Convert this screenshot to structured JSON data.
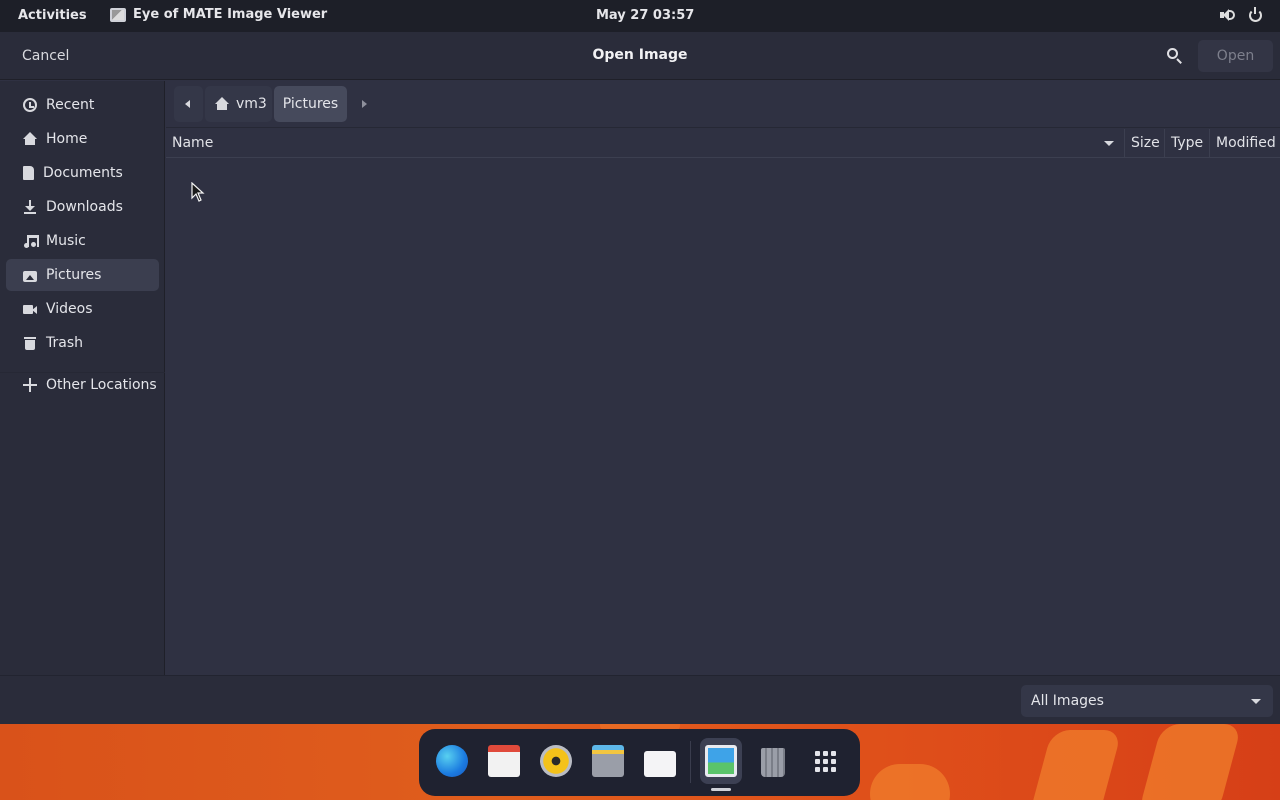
{
  "topbar": {
    "activities": "Activities",
    "app_name": "Eye of MATE Image Viewer",
    "clock": "May 27  03:57",
    "tray_icons": [
      "volume-icon",
      "power-icon"
    ]
  },
  "header": {
    "cancel_label": "Cancel",
    "title": "Open Image",
    "open_label": "Open",
    "search_icon": "search-icon"
  },
  "sidebar": {
    "items": [
      {
        "label": "Recent",
        "icon": "clock-icon"
      },
      {
        "label": "Home",
        "icon": "home-icon"
      },
      {
        "label": "Documents",
        "icon": "document-icon"
      },
      {
        "label": "Downloads",
        "icon": "download-icon"
      },
      {
        "label": "Music",
        "icon": "music-icon"
      },
      {
        "label": "Pictures",
        "icon": "picture-icon",
        "selected": true
      },
      {
        "label": "Videos",
        "icon": "video-icon"
      },
      {
        "label": "Trash",
        "icon": "trash-icon"
      },
      {
        "label": "Other Locations",
        "icon": "plus-icon"
      }
    ]
  },
  "pathbar": {
    "segments": [
      "vm3",
      "Pictures"
    ]
  },
  "columns": [
    "Name",
    "Size",
    "Type",
    "Modified"
  ],
  "files": [],
  "footer": {
    "filter_value": "All Images"
  },
  "dock": {
    "apps": [
      "browser-icon",
      "calendar-icon",
      "music-player-icon",
      "files-icon",
      "software-store-icon",
      "image-viewer-icon",
      "trash-icon",
      "app-grid-icon"
    ],
    "active": "image-viewer-icon"
  },
  "colors": {
    "accent": "#3b3e4f",
    "background": "#2f3142",
    "wallpaper": "#e05e1d"
  }
}
